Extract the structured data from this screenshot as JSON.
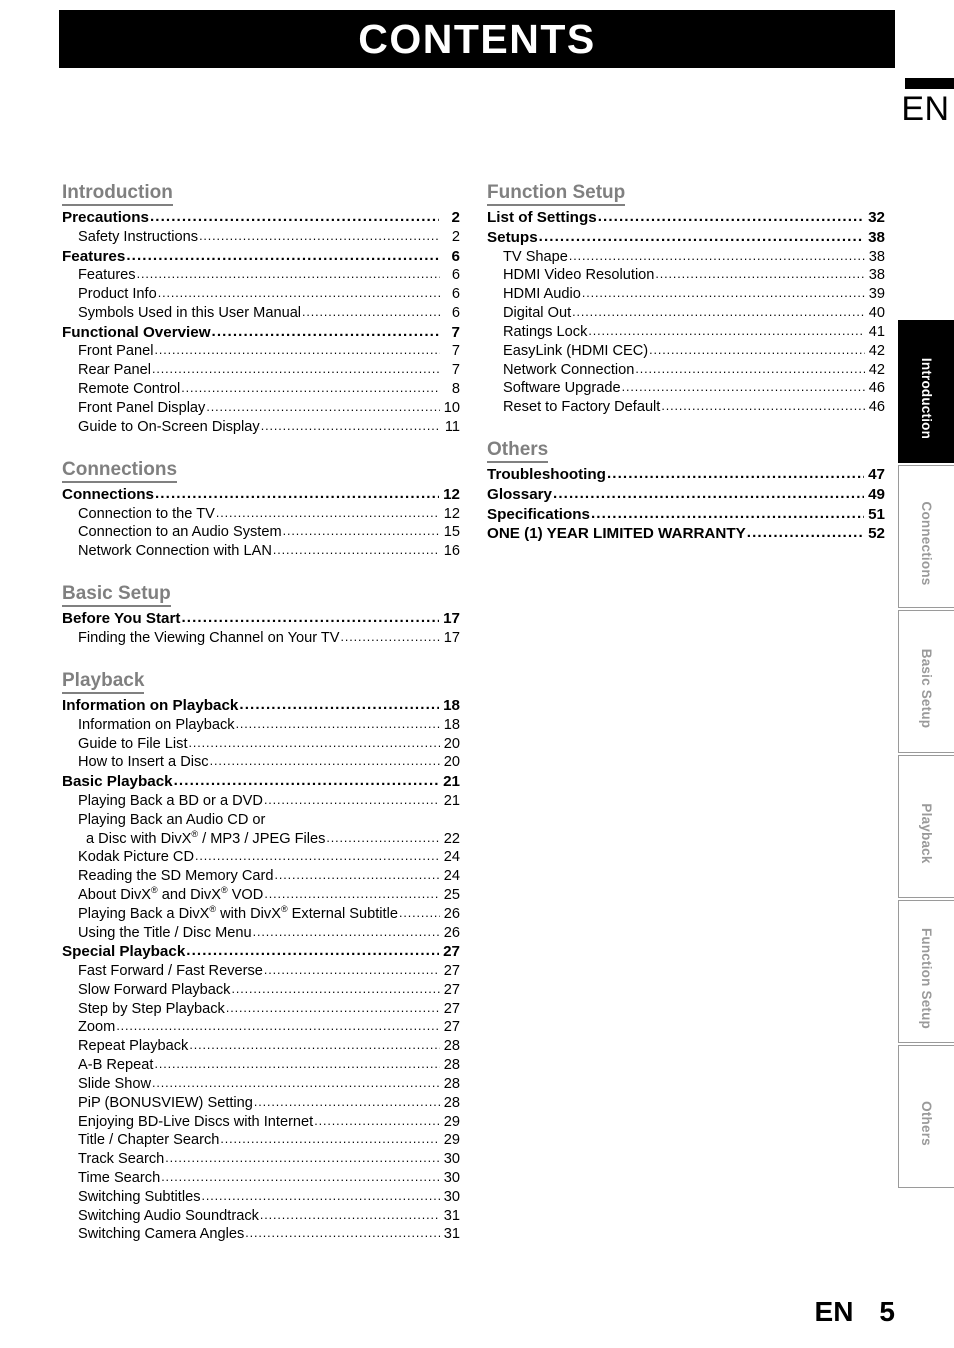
{
  "header": {
    "title": "CONTENTS"
  },
  "language_marker": {
    "code": "EN"
  },
  "footer": {
    "lang": "EN",
    "page_number": "5"
  },
  "side_tabs": [
    {
      "label": "Introduction",
      "active": true
    },
    {
      "label": "Connections",
      "active": false
    },
    {
      "label": "Basic Setup",
      "active": false
    },
    {
      "label": "Playback",
      "active": false
    },
    {
      "label": "Function Setup",
      "active": false
    },
    {
      "label": "Others",
      "active": false
    }
  ],
  "columns": {
    "left": [
      {
        "heading": "Introduction",
        "entries": [
          {
            "level": 1,
            "label": "Precautions",
            "page": "2"
          },
          {
            "level": 2,
            "label": "Safety Instructions",
            "page": "2"
          },
          {
            "level": 1,
            "label": "Features",
            "page": "6"
          },
          {
            "level": 2,
            "label": "Features",
            "page": "6"
          },
          {
            "level": 2,
            "label": "Product Info",
            "page": "6"
          },
          {
            "level": 2,
            "label": "Symbols Used in this User Manual",
            "page": "6"
          },
          {
            "level": 1,
            "label": "Functional Overview",
            "page": "7"
          },
          {
            "level": 2,
            "label": "Front Panel",
            "page": "7"
          },
          {
            "level": 2,
            "label": "Rear Panel",
            "page": "7"
          },
          {
            "level": 2,
            "label": "Remote Control",
            "page": "8"
          },
          {
            "level": 2,
            "label": "Front Panel Display",
            "page": "10"
          },
          {
            "level": 2,
            "label": "Guide to On-Screen Display",
            "page": "11"
          }
        ]
      },
      {
        "heading": "Connections",
        "entries": [
          {
            "level": 1,
            "label": "Connections",
            "page": "12"
          },
          {
            "level": 2,
            "label": "Connection to the TV",
            "page": "12"
          },
          {
            "level": 2,
            "label": "Connection to an Audio System",
            "page": "15"
          },
          {
            "level": 2,
            "label": "Network Connection with LAN",
            "page": "16"
          }
        ]
      },
      {
        "heading": "Basic Setup",
        "entries": [
          {
            "level": 1,
            "label": "Before You Start",
            "page": "17"
          },
          {
            "level": 2,
            "label": "Finding the Viewing Channel on Your TV",
            "page": "17"
          }
        ]
      },
      {
        "heading": "Playback",
        "entries": [
          {
            "level": 1,
            "label": "Information on Playback",
            "page": "18"
          },
          {
            "level": 2,
            "label": "Information on Playback",
            "page": "18"
          },
          {
            "level": 2,
            "label": "Guide to File List",
            "page": "20"
          },
          {
            "level": 2,
            "label": "How to Insert a Disc",
            "page": "20"
          },
          {
            "level": 1,
            "label": "Basic Playback",
            "page": "21"
          },
          {
            "level": 2,
            "label": "Playing Back a BD or a DVD",
            "page": "21"
          },
          {
            "level": 2,
            "label": "Playing Back an Audio CD or",
            "page": "",
            "wrap": "first"
          },
          {
            "level": 2,
            "label": "a Disc with DivX® / MP3 / JPEG Files",
            "page": "22",
            "wrap": "second"
          },
          {
            "level": 2,
            "label": "Kodak Picture CD",
            "page": "24"
          },
          {
            "level": 2,
            "label": "Reading the SD Memory Card",
            "page": "24"
          },
          {
            "level": 2,
            "label": "About DivX® and DivX® VOD",
            "page": "25"
          },
          {
            "level": 2,
            "label": "Playing Back a  DivX® with DivX® External Subtitle",
            "page": "26"
          },
          {
            "level": 2,
            "label": "Using the Title / Disc Menu",
            "page": "26"
          },
          {
            "level": 1,
            "label": "Special Playback",
            "page": "27"
          },
          {
            "level": 2,
            "label": "Fast Forward / Fast Reverse",
            "page": "27"
          },
          {
            "level": 2,
            "label": "Slow Forward Playback",
            "page": "27"
          },
          {
            "level": 2,
            "label": "Step by Step Playback",
            "page": "27"
          },
          {
            "level": 2,
            "label": "Zoom",
            "page": "27"
          },
          {
            "level": 2,
            "label": "Repeat Playback",
            "page": "28"
          },
          {
            "level": 2,
            "label": "A-B Repeat",
            "page": "28"
          },
          {
            "level": 2,
            "label": "Slide Show",
            "page": "28"
          },
          {
            "level": 2,
            "label": "PiP (BONUSVIEW) Setting",
            "page": "28"
          },
          {
            "level": 2,
            "label": "Enjoying BD-Live Discs with Internet",
            "page": "29"
          },
          {
            "level": 2,
            "label": "Title / Chapter Search",
            "page": "29"
          },
          {
            "level": 2,
            "label": "Track Search",
            "page": "30"
          },
          {
            "level": 2,
            "label": "Time Search",
            "page": "30"
          },
          {
            "level": 2,
            "label": "Switching Subtitles",
            "page": "30"
          },
          {
            "level": 2,
            "label": "Switching Audio Soundtrack",
            "page": "31"
          },
          {
            "level": 2,
            "label": "Switching Camera Angles",
            "page": "31"
          }
        ]
      }
    ],
    "right": [
      {
        "heading": "Function Setup",
        "entries": [
          {
            "level": 1,
            "label": "List of Settings",
            "page": "32"
          },
          {
            "level": 1,
            "label": "Setups",
            "page": "38"
          },
          {
            "level": 2,
            "label": "TV Shape",
            "page": "38"
          },
          {
            "level": 2,
            "label": "HDMI Video Resolution",
            "page": "38"
          },
          {
            "level": 2,
            "label": "HDMI Audio",
            "page": "39"
          },
          {
            "level": 2,
            "label": "Digital Out",
            "page": "40"
          },
          {
            "level": 2,
            "label": "Ratings Lock",
            "page": "41"
          },
          {
            "level": 2,
            "label": "EasyLink (HDMI CEC)",
            "page": "42"
          },
          {
            "level": 2,
            "label": "Network Connection",
            "page": "42"
          },
          {
            "level": 2,
            "label": "Software Upgrade",
            "page": "46"
          },
          {
            "level": 2,
            "label": "Reset to Factory Default",
            "page": "46"
          }
        ]
      },
      {
        "heading": "Others",
        "entries": [
          {
            "level": 1,
            "label": "Troubleshooting",
            "page": "47"
          },
          {
            "level": 1,
            "label": "Glossary",
            "page": "49"
          },
          {
            "level": 1,
            "label": "Specifications",
            "page": "51"
          },
          {
            "level": 1,
            "label": "ONE (1) YEAR LIMITED WARRANTY",
            "page": "52"
          }
        ]
      }
    ]
  }
}
